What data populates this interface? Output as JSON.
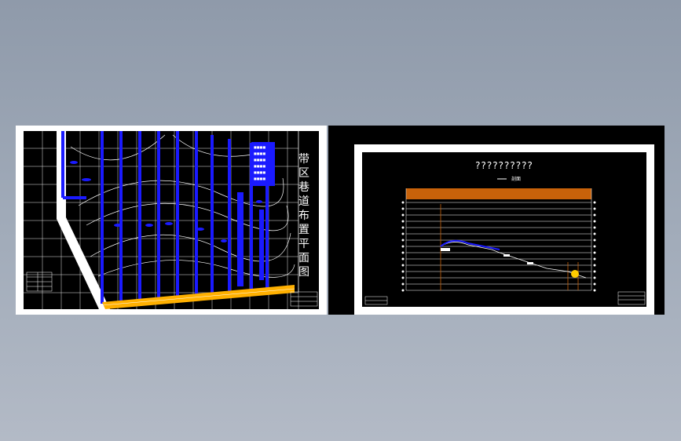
{
  "plan_sheet": {
    "title_chars": [
      "带",
      "区",
      "巷",
      "道",
      "布",
      "置",
      "平",
      "面",
      "图"
    ],
    "colors": {
      "roadway": "#1a1aff",
      "belt": "#ffb000",
      "grid": "#ffffff",
      "background": "#000000"
    }
  },
  "profile_sheet": {
    "title": "??????????",
    "legend_label": "剖面",
    "colors": {
      "header_band": "#c8620a",
      "profile_line": "#1a1aff",
      "marker": "#ffcc00"
    }
  }
}
